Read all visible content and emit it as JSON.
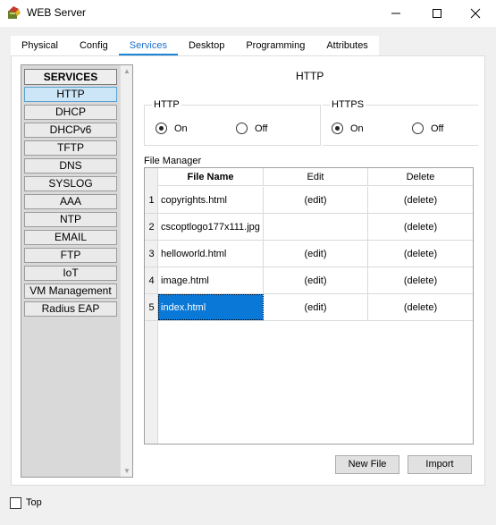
{
  "window": {
    "title": "WEB Server",
    "icon": "packet-tracer-server-icon",
    "controls": [
      "minimize-icon",
      "maximize-icon",
      "close-icon"
    ]
  },
  "tabs": [
    {
      "label": "Physical"
    },
    {
      "label": "Config"
    },
    {
      "label": "Services",
      "active": true
    },
    {
      "label": "Desktop"
    },
    {
      "label": "Programming"
    },
    {
      "label": "Attributes"
    }
  ],
  "sidebar": {
    "header": "SERVICES",
    "items": [
      {
        "label": "HTTP",
        "selected": true
      },
      {
        "label": "DHCP"
      },
      {
        "label": "DHCPv6"
      },
      {
        "label": "TFTP"
      },
      {
        "label": "DNS"
      },
      {
        "label": "SYSLOG"
      },
      {
        "label": "AAA"
      },
      {
        "label": "NTP"
      },
      {
        "label": "EMAIL"
      },
      {
        "label": "FTP"
      },
      {
        "label": "IoT"
      },
      {
        "label": "VM Management"
      },
      {
        "label": "Radius EAP"
      }
    ]
  },
  "main": {
    "title": "HTTP",
    "http": {
      "label": "HTTP",
      "on_label": "On",
      "off_label": "Off",
      "value": "On"
    },
    "https": {
      "label": "HTTPS",
      "on_label": "On",
      "off_label": "Off",
      "value": "On"
    },
    "file_manager": {
      "label": "File Manager",
      "columns": [
        "File Name",
        "Edit",
        "Delete"
      ],
      "rows": [
        {
          "num": "1",
          "name": "copyrights.html",
          "edit": "(edit)",
          "del": "(delete)"
        },
        {
          "num": "2",
          "name": "cscoptlogo177x111.jpg",
          "edit": "",
          "del": "(delete)"
        },
        {
          "num": "3",
          "name": "helloworld.html",
          "edit": "(edit)",
          "del": "(delete)"
        },
        {
          "num": "4",
          "name": "image.html",
          "edit": "(edit)",
          "del": "(delete)"
        },
        {
          "num": "5",
          "name": "index.html",
          "edit": "(edit)",
          "del": "(delete)",
          "selected": true
        }
      ]
    },
    "buttons": {
      "new_file": "New File",
      "import": "Import"
    }
  },
  "footer": {
    "top_label": "Top",
    "top_checked": false
  },
  "colors": {
    "accent": "#1c85d6",
    "selection": "#0a78d7"
  }
}
